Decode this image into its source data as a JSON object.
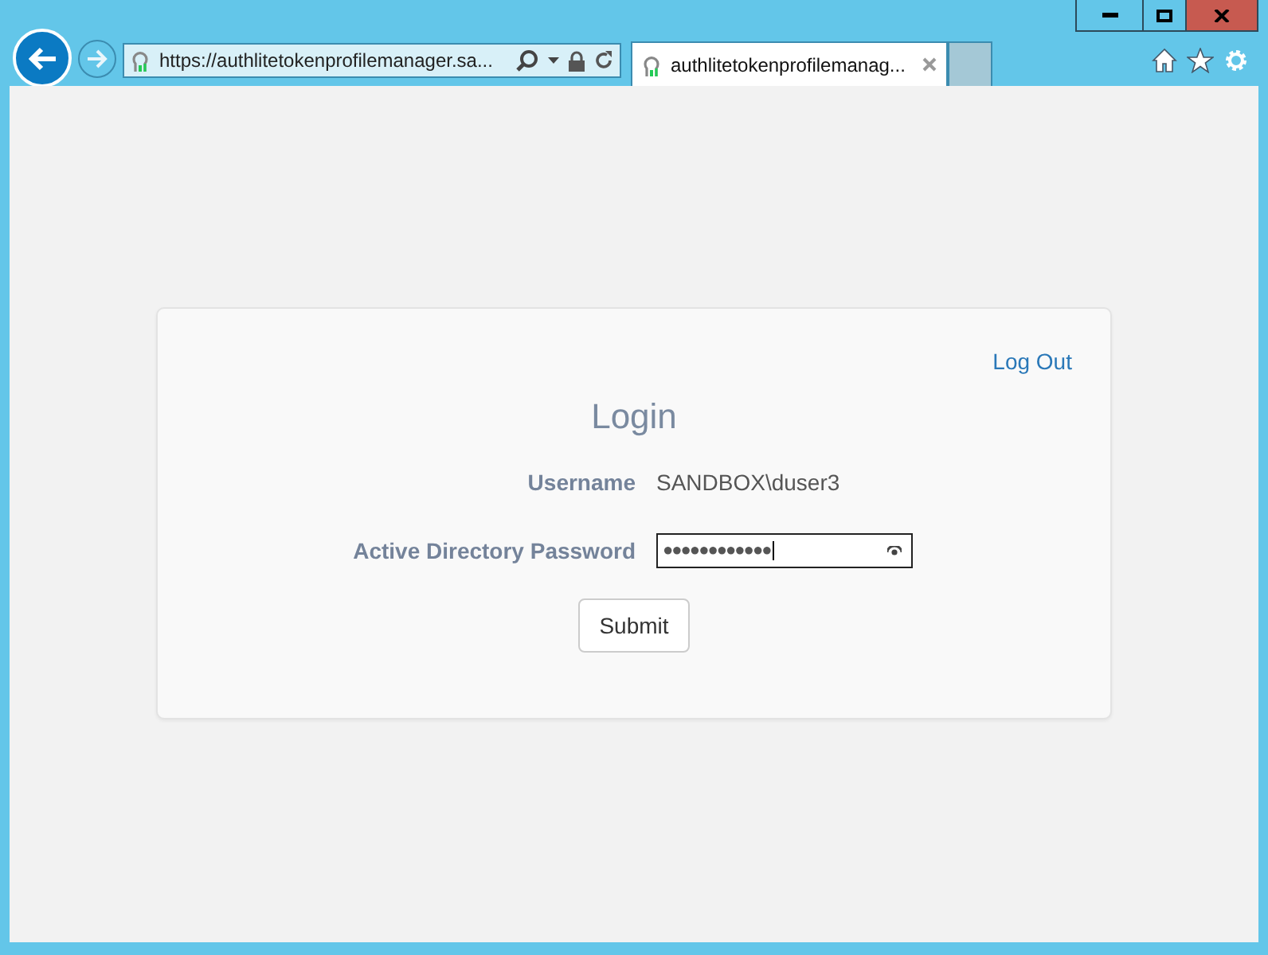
{
  "browser": {
    "address": "https://authlitetokenprofilemanager.sa...",
    "tabs": [
      {
        "title": "authlitetokenprofilemanag...",
        "selected": true
      }
    ]
  },
  "page": {
    "logout_link": "Log Out",
    "heading": "Login",
    "fields": [
      {
        "kind": "static",
        "label": "Username",
        "value": "SANDBOX\\duser3"
      },
      {
        "kind": "password",
        "label": "Active Directory Password",
        "value": "●●●●●●●●●●●●"
      }
    ],
    "submit": "Submit"
  }
}
